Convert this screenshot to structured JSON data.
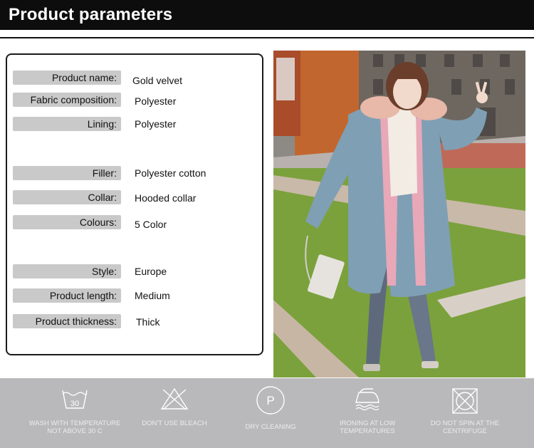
{
  "header": {
    "title": "Product parameters"
  },
  "params": [
    {
      "label": "Product  name:",
      "value": "Gold velvet"
    },
    {
      "label": "Fabric composition:",
      "value": "Polyester"
    },
    {
      "label": "Lining:",
      "value": "Polyester"
    },
    {
      "label": "Filler:",
      "value": "Polyester cotton"
    },
    {
      "label": "Collar:",
      "value": "Hooded collar"
    },
    {
      "label": "Colours:",
      "value": "5 Color"
    },
    {
      "label": "Style:",
      "value": "Europe"
    },
    {
      "label": "Product length:",
      "value": "Medium"
    },
    {
      "label": "Product thickness:",
      "value": "Thick"
    }
  ],
  "care": [
    {
      "icon": "wash-30-icon",
      "text": "WASH WITH TEMPERATURE NOT ABOVE 30 C",
      "icon_text": "30"
    },
    {
      "icon": "no-bleach-icon",
      "text": "DON'T USE BLEACH"
    },
    {
      "icon": "dry-cleaning-icon",
      "text": "DRY CLEANING",
      "icon_text": "P"
    },
    {
      "icon": "iron-low-icon",
      "text": "IRONING AT LOW TEMPERATURES"
    },
    {
      "icon": "no-spin-icon",
      "text": "DO NOT SPIN AT THE CENTRIFUGE"
    }
  ],
  "colors": {
    "header_bg": "#0d0d0d",
    "label_bg": "#c9c9c9",
    "care_bg": "#b9b9bb",
    "care_fg": "#ececec",
    "jacket": "#7f9fb4",
    "lining": "#e8a8b8"
  }
}
